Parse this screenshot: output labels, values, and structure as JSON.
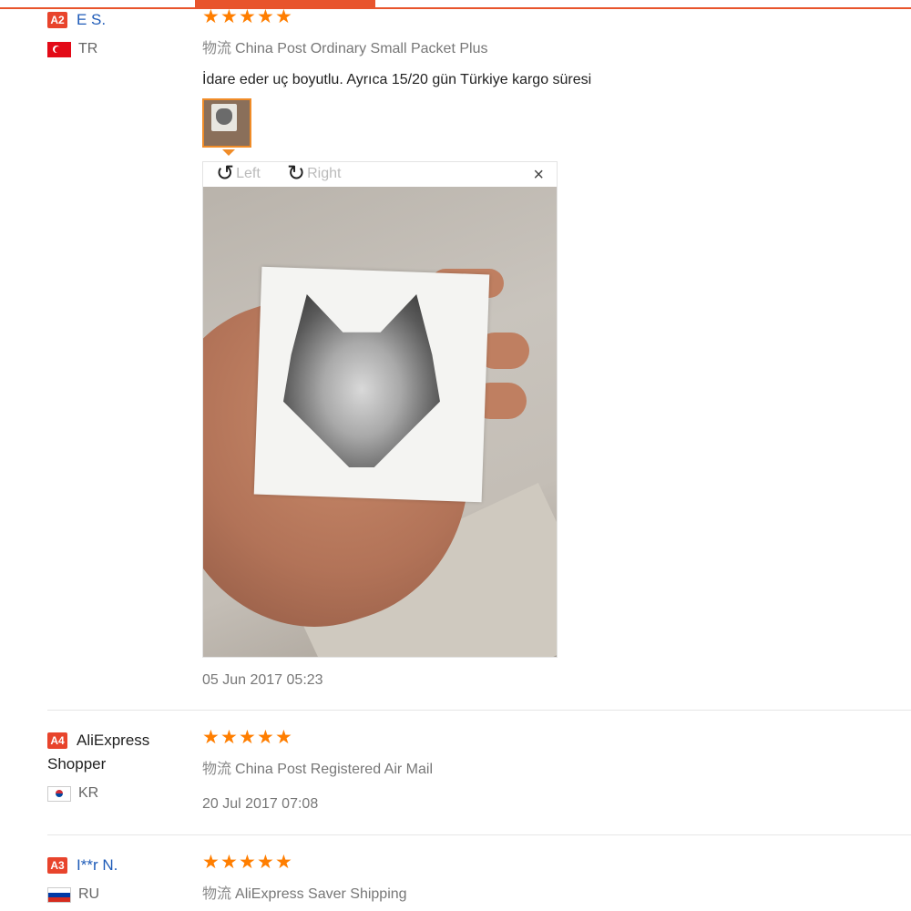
{
  "reviews": [
    {
      "level": "A2",
      "name": "E S.",
      "country": "TR",
      "stars": 5,
      "shipping_prefix": "物流",
      "shipping": "China Post Ordinary Small Packet Plus",
      "text": "İdare eder uç boyutlu. Ayrıca 15/20 gün Türkiye kargo süresi",
      "date": "05 Jun 2017 05:23"
    },
    {
      "level": "A4",
      "name": "AliExpress Shopper",
      "country": "KR",
      "stars": 5,
      "shipping_prefix": "物流",
      "shipping": "China Post Registered Air Mail",
      "date": "20 Jul 2017 07:08"
    },
    {
      "level": "A3",
      "name": "I**r N.",
      "country": "RU",
      "stars": 5,
      "shipping_prefix": "物流",
      "shipping": "AliExpress Saver Shipping"
    }
  ],
  "viewer": {
    "rotate_left_label": "Left",
    "rotate_right_label": "Right",
    "close_glyph": "×",
    "rotate_left_icon": "rotate-left-icon",
    "rotate_right_icon": "rotate-right-icon"
  },
  "colors": {
    "accent": "#e8542c",
    "star": "#ff7e00",
    "badge": "#e8442c",
    "link": "#1e5bb8",
    "thumb_border": "#f08c28"
  }
}
